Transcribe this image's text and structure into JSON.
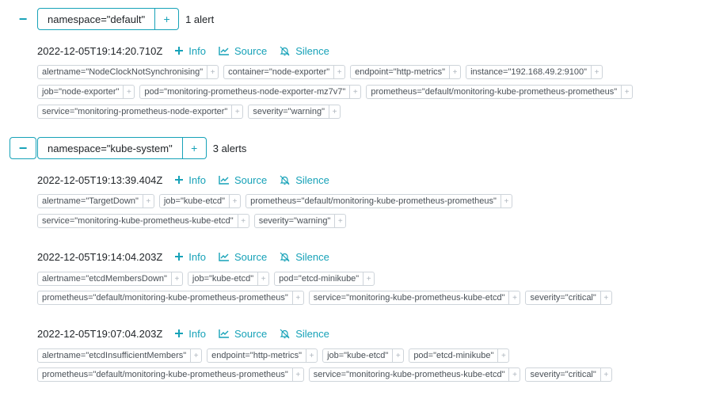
{
  "groups": [
    {
      "label": "namespace=\"default\"",
      "plus": "+",
      "count": "1 alert",
      "collapse_icon": "minus-icon",
      "alerts": [
        {
          "time": "2022-12-05T19:14:20.710Z",
          "rows": [
            [
              "alertname=\"NodeClockNotSynchronising\"",
              "container=\"node-exporter\"",
              "endpoint=\"http-metrics\"",
              "instance=\"192.168.49.2:9100\""
            ],
            [
              "job=\"node-exporter\"",
              "pod=\"monitoring-prometheus-node-exporter-mz7v7\"",
              "prometheus=\"default/monitoring-kube-prometheus-prometheus\""
            ],
            [
              "service=\"monitoring-prometheus-node-exporter\"",
              "severity=\"warning\""
            ]
          ]
        }
      ]
    },
    {
      "label": "namespace=\"kube-system\"",
      "plus": "+",
      "count": "3 alerts",
      "collapse_icon": "minus-icon",
      "alerts": [
        {
          "time": "2022-12-05T19:13:39.404Z",
          "rows": [
            [
              "alertname=\"TargetDown\"",
              "job=\"kube-etcd\"",
              "prometheus=\"default/monitoring-kube-prometheus-prometheus\""
            ],
            [
              "service=\"monitoring-kube-prometheus-kube-etcd\"",
              "severity=\"warning\""
            ]
          ]
        },
        {
          "time": "2022-12-05T19:14:04.203Z",
          "rows": [
            [
              "alertname=\"etcdMembersDown\"",
              "job=\"kube-etcd\"",
              "pod=\"etcd-minikube\""
            ],
            [
              "prometheus=\"default/monitoring-kube-prometheus-prometheus\"",
              "service=\"monitoring-kube-prometheus-kube-etcd\"",
              "severity=\"critical\""
            ]
          ]
        },
        {
          "time": "2022-12-05T19:07:04.203Z",
          "rows": [
            [
              "alertname=\"etcdInsufficientMembers\"",
              "endpoint=\"http-metrics\"",
              "job=\"kube-etcd\"",
              "pod=\"etcd-minikube\""
            ],
            [
              "prometheus=\"default/monitoring-kube-prometheus-prometheus\"",
              "service=\"monitoring-kube-prometheus-kube-etcd\"",
              "severity=\"critical\""
            ]
          ]
        }
      ]
    }
  ],
  "actions": {
    "info_label": "Info",
    "source_label": "Source",
    "silence_label": "Silence",
    "info_icon": "plus-icon",
    "source_icon": "chart-line-icon",
    "silence_icon": "bell-slash-icon"
  },
  "label_plus": "+",
  "colors": {
    "accent": "#17a2b8",
    "label_border": "#ced4da",
    "text": "#212529"
  }
}
